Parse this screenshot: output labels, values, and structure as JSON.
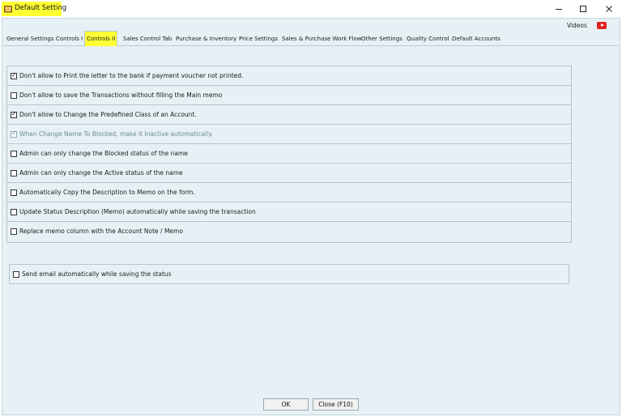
{
  "window": {
    "title": "Default Setting",
    "controls": [
      "minimize",
      "maximize",
      "close"
    ]
  },
  "header_links": {
    "videos_label": "Videos",
    "youtube_icon": "youtube-icon"
  },
  "tabs": [
    {
      "label": "General Settings",
      "active": false
    },
    {
      "label": "Controls I",
      "active": false
    },
    {
      "label": "Controls II",
      "active": true
    },
    {
      "label": "Sales Control Tab",
      "active": false
    },
    {
      "label": "Purchase & Inventory",
      "active": false
    },
    {
      "label": "Price Settings",
      "active": false
    },
    {
      "label": "Sales & Purchase Work Flow",
      "active": false
    },
    {
      "label": "Other Settings",
      "active": false
    },
    {
      "label": "Quality Control",
      "active": false
    },
    {
      "label": "Default Accounts",
      "active": false
    }
  ],
  "options": [
    {
      "label": "Don't allow to Print the letter to the bank if payment voucher not printed.",
      "checked": true,
      "enabled": true
    },
    {
      "label": "Don't allow to save the Transactions without filling the Main memo",
      "checked": false,
      "enabled": true
    },
    {
      "label": "Don't allow to Change the Predefined Class of an Account.",
      "checked": true,
      "enabled": true
    },
    {
      "label": "When Change Name To Blocked, make it Inactive automatically.",
      "checked": true,
      "enabled": false
    },
    {
      "label": "Admin can only change the Blocked status of the name",
      "checked": false,
      "enabled": true
    },
    {
      "label": "Admin can only change the Active status of the name",
      "checked": false,
      "enabled": true
    },
    {
      "label": "Automatically Copy the Description to Memo on the form.",
      "checked": false,
      "enabled": true
    },
    {
      "label": "Update Status Description (Memo) automatically while saving the transaction",
      "checked": false,
      "enabled": true
    },
    {
      "label": "Replace memo column with the Account Note / Memo",
      "checked": false,
      "enabled": true
    }
  ],
  "email_option": {
    "label": "Send email automatically while saving the status",
    "checked": false
  },
  "buttons": {
    "ok_label": "OK",
    "close_label": "Close (F10)"
  },
  "colors": {
    "highlight": "#ffff33",
    "client_background": "#e7f1f5",
    "youtube_red": "#e02020"
  }
}
